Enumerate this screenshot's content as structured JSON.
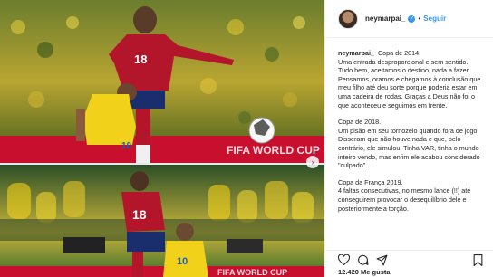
{
  "header": {
    "username": "neymarpai_",
    "separator": "•",
    "follow_label": "Seguir"
  },
  "caption": {
    "author": "neymarpai_",
    "paragraphs": [
      "Copa de 2014.\nUma entrada desproporcional e sem sentido. Tudo bem, aceitamos o destino, nada a fazer. Pensamos, oramos e chegamos à conclusão que meu filho até deu sorte porque poderia estar em uma cadeira de rodas. Graças a Deus não foi o que aconteceu e seguimos em frente.",
      "Copa de 2018.\nUm pisão em seu tornozelo quando fora de jogo. Disseram que não houve nada e que, pelo contrário, ele simulou. Tinha VAR, tinha o mundo inteiro vendo, mas enfim ele acabou considerado \"culpado\"..",
      "Copa da França 2019.\n4 faltas consecutivas, no mesmo lance (!!) até conseguirem provocar o desequilíbrio dele e posteriormente a torção."
    ]
  },
  "footer": {
    "likes": "12.420 Me gusta"
  },
  "media": {
    "top_jersey_number": "18",
    "top_yellow_number": "10",
    "bottom_jersey_number": "18",
    "bottom_yellow_number": "10",
    "board_text_top": "FIFA WORLD CUP",
    "board_text_bottom": "FIFA WORLD CUP"
  },
  "colors": {
    "link_blue": "#3897f0",
    "colombia_red": "#b3162b",
    "brazil_yellow": "#f2d11a"
  }
}
